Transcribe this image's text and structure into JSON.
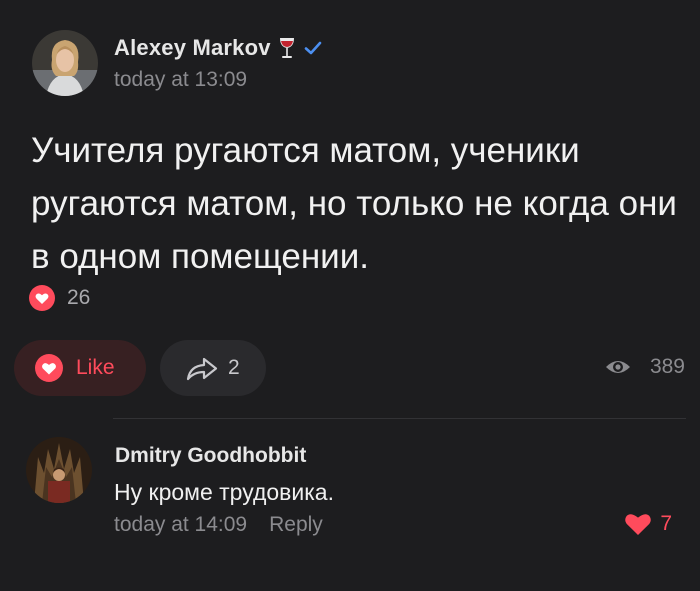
{
  "post": {
    "author": {
      "name": "Alexey Markov",
      "badge_icon": "wine-glass-icon",
      "verified_icon": "verified-check-icon"
    },
    "time": "today at 13:09",
    "text": "Учителя ругаются матом, ученики ругаются матом, но только не когда они в одном помещении.",
    "reactions": {
      "icon": "heart-icon",
      "count": "26"
    },
    "actions": {
      "like_label": "Like",
      "share_count": "2",
      "views_count": "389"
    }
  },
  "comment": {
    "author": "Dmitry Goodhobbit",
    "text": "Ну кроме трудовика.",
    "time": "today at 14:09",
    "reply_label": "Reply",
    "likes": "7"
  },
  "colors": {
    "background": "#1d1d1f",
    "accent_red": "#ff4b5c",
    "verified_blue": "#4c8ff0",
    "muted_text": "#8b8b8f"
  }
}
